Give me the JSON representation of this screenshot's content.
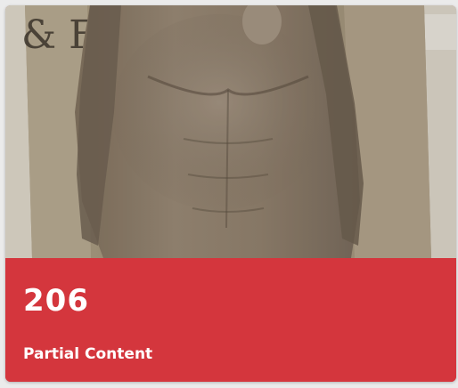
{
  "card": {
    "status_code": "206",
    "status_text": "Partial Content",
    "accent_color": "#d4363d",
    "photo_icon": "photo-image"
  }
}
